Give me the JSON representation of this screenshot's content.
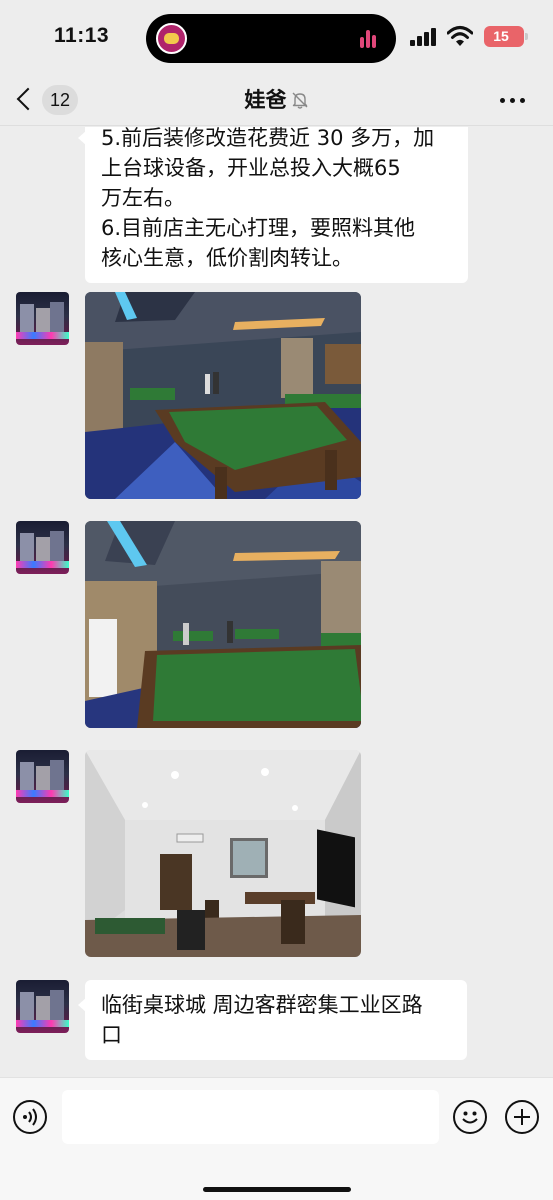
{
  "status_bar": {
    "time": "11:13",
    "battery_level": "15",
    "battery_color": "#e96469",
    "island_app_icon": "music-app-icon",
    "island_activity_icon": "audio-bars-icon"
  },
  "nav": {
    "back_icon": "chevron-left-icon",
    "unread_count": "12",
    "title": "娃爸",
    "muted": true,
    "mute_icon": "bell-off-icon",
    "more_icon": "more-dots-icon"
  },
  "messages": [
    {
      "type": "text",
      "lines": [
        "5.前后装修改造花费近 30 多万，加",
        "上台球设备，开业总投入大概65",
        "万左右。",
        "6.目前店主无心打理，要照料其他",
        "核心生意，低价割肉转让。"
      ]
    },
    {
      "type": "image",
      "avatar": "avatar-city-night",
      "subject": "billiard hall with green pool tables under blue ceiling lights"
    },
    {
      "type": "image",
      "avatar": "avatar-city-night",
      "subject": "billiard hall interior, green table in foreground"
    },
    {
      "type": "image",
      "avatar": "avatar-city-night",
      "subject": "lounge room with tea table, TV and chairs"
    },
    {
      "type": "text",
      "avatar": "avatar-city-night",
      "lines": [
        "临街桌球城 周边客群密集工业区路",
        "口"
      ]
    }
  ],
  "input_bar": {
    "placeholder": "",
    "voice_icon": "voice-wave-icon",
    "emoji_icon": "smile-icon",
    "plus_icon": "plus-circle-icon"
  },
  "colors": {
    "background": "#ededed",
    "bubble": "#ffffff",
    "table_felt": "#2f7a36"
  }
}
